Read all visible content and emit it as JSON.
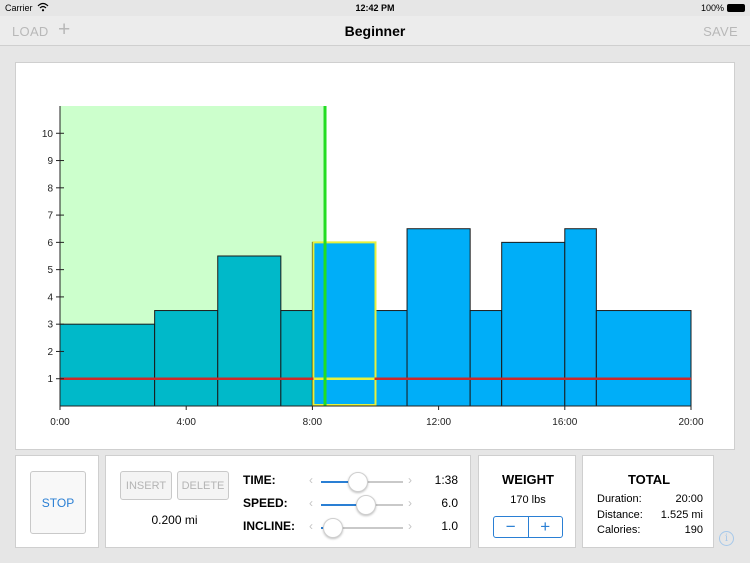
{
  "status_bar": {
    "carrier": "Carrier",
    "time": "12:42 PM",
    "battery": "100%"
  },
  "nav": {
    "load_label": "LOAD",
    "add_label": "+",
    "title": "Beginner",
    "save_label": "SAVE"
  },
  "chart_data": {
    "type": "bar",
    "x_unit": "minutes",
    "xlim": [
      0,
      20
    ],
    "ylim": [
      0,
      11
    ],
    "x_ticks": [
      "0:00",
      "4:00",
      "8:00",
      "12:00",
      "16:00",
      "20:00"
    ],
    "y_ticks": [
      "1",
      "2",
      "3",
      "4",
      "5",
      "6",
      "7",
      "8",
      "9",
      "10"
    ],
    "segments": [
      {
        "start": 0,
        "end": 3,
        "value": 3.0
      },
      {
        "start": 3,
        "end": 5,
        "value": 3.5
      },
      {
        "start": 5,
        "end": 7,
        "value": 5.5
      },
      {
        "start": 7,
        "end": 8,
        "value": 3.5
      },
      {
        "start": 8,
        "end": 10,
        "value": 6.0,
        "selected": true
      },
      {
        "start": 10,
        "end": 11,
        "value": 3.5
      },
      {
        "start": 11,
        "end": 13,
        "value": 6.5
      },
      {
        "start": 13,
        "end": 14,
        "value": 3.5
      },
      {
        "start": 14,
        "end": 16,
        "value": 6.0
      },
      {
        "start": 16,
        "end": 17,
        "value": 6.5
      },
      {
        "start": 17,
        "end": 20,
        "value": 3.5
      }
    ],
    "incline_line_value": 1.0,
    "current_time": 8.4,
    "colors": {
      "completed": "#00b9c9",
      "remaining": "#00aef8",
      "elapsed_region": "#ccffcc",
      "progress_line": "#22dd22",
      "incline_line": "#cc2a2a",
      "selected_outline": "#e6f03c"
    }
  },
  "controls": {
    "stop_label": "STOP",
    "insert_label": "INSERT",
    "delete_label": "DELETE",
    "distance": "0.200 mi",
    "rows": [
      {
        "label": "TIME:",
        "value": "1:38",
        "level": 0.45
      },
      {
        "label": "SPEED:",
        "value": "6.0",
        "level": 0.55
      },
      {
        "label": "INCLINE:",
        "value": "1.0",
        "level": 0.15
      }
    ]
  },
  "weight": {
    "title": "WEIGHT",
    "value": "170 lbs",
    "minus": "−",
    "plus": "+"
  },
  "total": {
    "title": "TOTAL",
    "rows": [
      {
        "label": "Duration:",
        "value": "20:00"
      },
      {
        "label": "Distance:",
        "value": "1.525 mi"
      },
      {
        "label": "Calories:",
        "value": "190"
      }
    ]
  },
  "icons": {
    "wifi": "wifi-icon",
    "battery": "battery-icon",
    "info": "info-icon"
  },
  "accent_color": "#2a7fd4"
}
